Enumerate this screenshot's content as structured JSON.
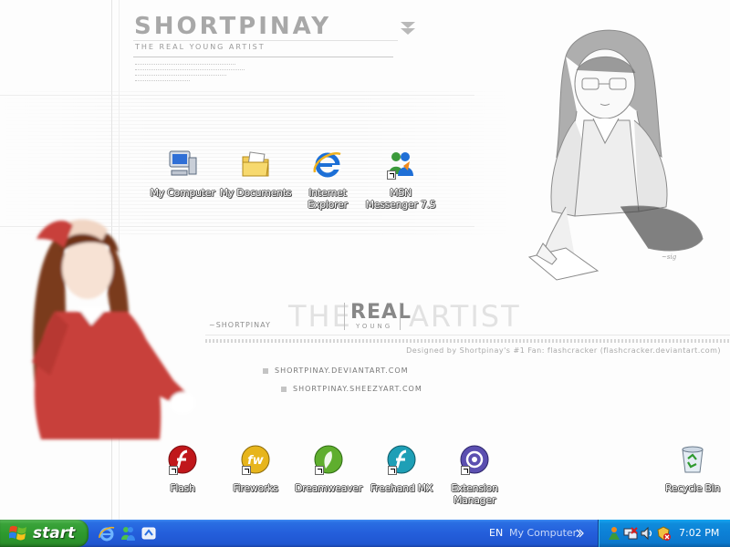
{
  "wallpaper": {
    "logo_title": "SHORTPINAY",
    "logo_subtitle": "THE REAL YOUNG ARTIST",
    "tagline_handle": "~SHORTPINAY",
    "tagline_the": "THE",
    "tagline_real": "REAL",
    "tagline_young": "YOUNG",
    "tagline_artist": "ARTIST",
    "designed_by": "Designed by Shortpinay's #1 Fan: flashcracker (flashcracker.deviantart.com)",
    "links": [
      "SHORTPINAY.DEVIANTART.COM",
      "SHORTPINAY.SHEEZYART.COM"
    ]
  },
  "desktop_icons": {
    "my_computer": "My Computer",
    "my_documents": "My Documents",
    "internet_explorer": "Internet Explorer",
    "msn_messenger": "MSN Messenger 7.5",
    "flash": "Flash",
    "fireworks": "Fireworks",
    "dreamweaver": "Dreamweaver",
    "freehand": "Freehand MX",
    "extension_manager": "Extension Manager",
    "recycle_bin": "Recycle Bin"
  },
  "taskbar": {
    "start_label": "start",
    "language": "EN",
    "address_label": "My Computer",
    "quick_launch_icons": [
      "internet-explorer-icon",
      "msn-messenger-icon",
      "show-desktop-icon"
    ],
    "tray_icons": [
      "msn-status-icon",
      "network-icon",
      "volume-icon",
      "security-alert-icon"
    ],
    "clock": "7:02 PM",
    "colors": {
      "bar": "#245edb",
      "start": "#2e9a2e",
      "tray": "#0c80d6"
    }
  }
}
